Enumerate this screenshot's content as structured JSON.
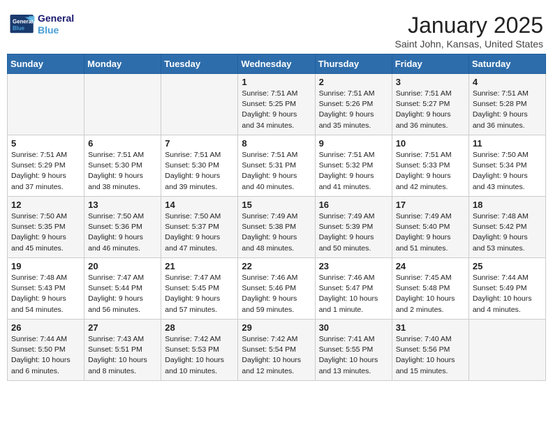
{
  "header": {
    "logo_line1": "General",
    "logo_line2": "Blue",
    "month": "January 2025",
    "location": "Saint John, Kansas, United States"
  },
  "weekdays": [
    "Sunday",
    "Monday",
    "Tuesday",
    "Wednesday",
    "Thursday",
    "Friday",
    "Saturday"
  ],
  "weeks": [
    [
      {
        "day": "",
        "info": ""
      },
      {
        "day": "",
        "info": ""
      },
      {
        "day": "",
        "info": ""
      },
      {
        "day": "1",
        "info": "Sunrise: 7:51 AM\nSunset: 5:25 PM\nDaylight: 9 hours and 34 minutes."
      },
      {
        "day": "2",
        "info": "Sunrise: 7:51 AM\nSunset: 5:26 PM\nDaylight: 9 hours and 35 minutes."
      },
      {
        "day": "3",
        "info": "Sunrise: 7:51 AM\nSunset: 5:27 PM\nDaylight: 9 hours and 36 minutes."
      },
      {
        "day": "4",
        "info": "Sunrise: 7:51 AM\nSunset: 5:28 PM\nDaylight: 9 hours and 36 minutes."
      }
    ],
    [
      {
        "day": "5",
        "info": "Sunrise: 7:51 AM\nSunset: 5:29 PM\nDaylight: 9 hours and 37 minutes."
      },
      {
        "day": "6",
        "info": "Sunrise: 7:51 AM\nSunset: 5:30 PM\nDaylight: 9 hours and 38 minutes."
      },
      {
        "day": "7",
        "info": "Sunrise: 7:51 AM\nSunset: 5:30 PM\nDaylight: 9 hours and 39 minutes."
      },
      {
        "day": "8",
        "info": "Sunrise: 7:51 AM\nSunset: 5:31 PM\nDaylight: 9 hours and 40 minutes."
      },
      {
        "day": "9",
        "info": "Sunrise: 7:51 AM\nSunset: 5:32 PM\nDaylight: 9 hours and 41 minutes."
      },
      {
        "day": "10",
        "info": "Sunrise: 7:51 AM\nSunset: 5:33 PM\nDaylight: 9 hours and 42 minutes."
      },
      {
        "day": "11",
        "info": "Sunrise: 7:50 AM\nSunset: 5:34 PM\nDaylight: 9 hours and 43 minutes."
      }
    ],
    [
      {
        "day": "12",
        "info": "Sunrise: 7:50 AM\nSunset: 5:35 PM\nDaylight: 9 hours and 45 minutes."
      },
      {
        "day": "13",
        "info": "Sunrise: 7:50 AM\nSunset: 5:36 PM\nDaylight: 9 hours and 46 minutes."
      },
      {
        "day": "14",
        "info": "Sunrise: 7:50 AM\nSunset: 5:37 PM\nDaylight: 9 hours and 47 minutes."
      },
      {
        "day": "15",
        "info": "Sunrise: 7:49 AM\nSunset: 5:38 PM\nDaylight: 9 hours and 48 minutes."
      },
      {
        "day": "16",
        "info": "Sunrise: 7:49 AM\nSunset: 5:39 PM\nDaylight: 9 hours and 50 minutes."
      },
      {
        "day": "17",
        "info": "Sunrise: 7:49 AM\nSunset: 5:40 PM\nDaylight: 9 hours and 51 minutes."
      },
      {
        "day": "18",
        "info": "Sunrise: 7:48 AM\nSunset: 5:42 PM\nDaylight: 9 hours and 53 minutes."
      }
    ],
    [
      {
        "day": "19",
        "info": "Sunrise: 7:48 AM\nSunset: 5:43 PM\nDaylight: 9 hours and 54 minutes."
      },
      {
        "day": "20",
        "info": "Sunrise: 7:47 AM\nSunset: 5:44 PM\nDaylight: 9 hours and 56 minutes."
      },
      {
        "day": "21",
        "info": "Sunrise: 7:47 AM\nSunset: 5:45 PM\nDaylight: 9 hours and 57 minutes."
      },
      {
        "day": "22",
        "info": "Sunrise: 7:46 AM\nSunset: 5:46 PM\nDaylight: 9 hours and 59 minutes."
      },
      {
        "day": "23",
        "info": "Sunrise: 7:46 AM\nSunset: 5:47 PM\nDaylight: 10 hours and 1 minute."
      },
      {
        "day": "24",
        "info": "Sunrise: 7:45 AM\nSunset: 5:48 PM\nDaylight: 10 hours and 2 minutes."
      },
      {
        "day": "25",
        "info": "Sunrise: 7:44 AM\nSunset: 5:49 PM\nDaylight: 10 hours and 4 minutes."
      }
    ],
    [
      {
        "day": "26",
        "info": "Sunrise: 7:44 AM\nSunset: 5:50 PM\nDaylight: 10 hours and 6 minutes."
      },
      {
        "day": "27",
        "info": "Sunrise: 7:43 AM\nSunset: 5:51 PM\nDaylight: 10 hours and 8 minutes."
      },
      {
        "day": "28",
        "info": "Sunrise: 7:42 AM\nSunset: 5:53 PM\nDaylight: 10 hours and 10 minutes."
      },
      {
        "day": "29",
        "info": "Sunrise: 7:42 AM\nSunset: 5:54 PM\nDaylight: 10 hours and 12 minutes."
      },
      {
        "day": "30",
        "info": "Sunrise: 7:41 AM\nSunset: 5:55 PM\nDaylight: 10 hours and 13 minutes."
      },
      {
        "day": "31",
        "info": "Sunrise: 7:40 AM\nSunset: 5:56 PM\nDaylight: 10 hours and 15 minutes."
      },
      {
        "day": "",
        "info": ""
      }
    ]
  ]
}
